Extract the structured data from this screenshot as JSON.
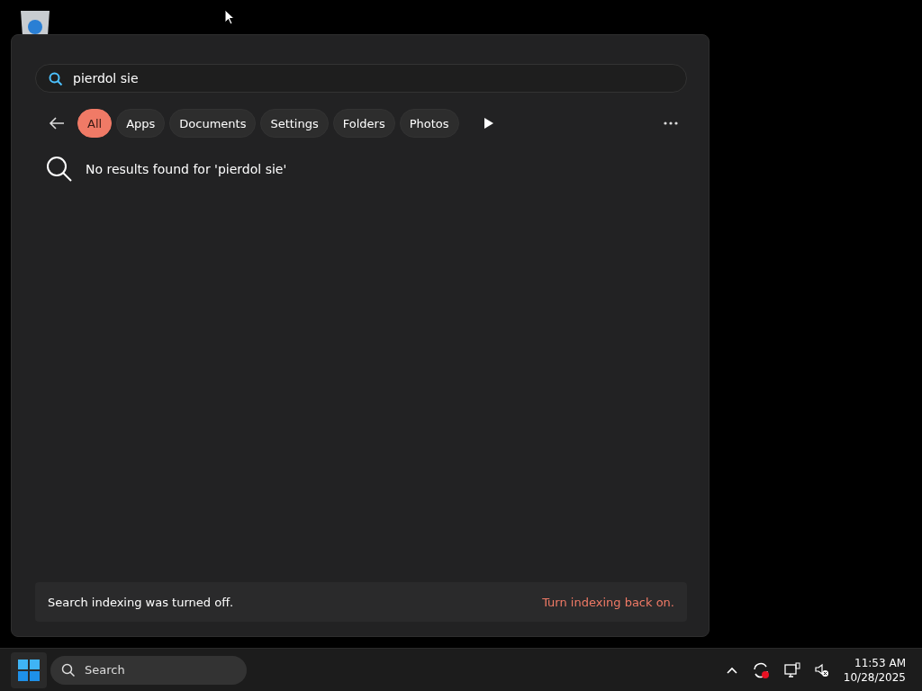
{
  "search_panel": {
    "query": "pierdol sie",
    "filters": [
      {
        "label": "All",
        "selected": true
      },
      {
        "label": "Apps",
        "selected": false
      },
      {
        "label": "Documents",
        "selected": false
      },
      {
        "label": "Settings",
        "selected": false
      },
      {
        "label": "Folders",
        "selected": false
      },
      {
        "label": "Photos",
        "selected": false
      }
    ],
    "message": "No results found for 'pierdol sie'",
    "indexing_notice": "Search indexing was turned off.",
    "indexing_link": "Turn indexing back on."
  },
  "taskbar": {
    "search_placeholder": "Search",
    "time": "11:53 AM",
    "date": "10/28/2025"
  }
}
